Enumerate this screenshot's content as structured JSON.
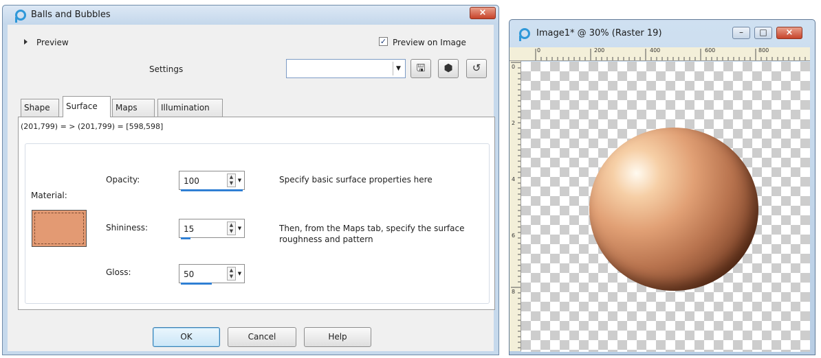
{
  "dialog": {
    "title": "Balls and Bubbles",
    "close_glyph": "×",
    "preview_label": "Preview",
    "preview_on_image_label": "Preview on Image",
    "preview_on_image_checked": true,
    "settings_label": "Settings",
    "settings_value": "",
    "tabs": [
      {
        "label": "Shape",
        "active": false
      },
      {
        "label": "Surface",
        "active": true
      },
      {
        "label": "Maps",
        "active": false
      },
      {
        "label": "Illumination",
        "active": false
      }
    ],
    "coord_readout": "(201,799) = > (201,799) = [598,598]",
    "material_label": "Material:",
    "material_color": "#e39a73",
    "fields": {
      "opacity": {
        "label": "Opacity:",
        "value": "100",
        "level": 1.0
      },
      "shininess": {
        "label": "Shininess:",
        "value": "15",
        "level": 0.15
      },
      "gloss": {
        "label": "Gloss:",
        "value": "50",
        "level": 0.5
      }
    },
    "help_text_1": "Specify basic surface properties here",
    "help_text_2": "Then, from the Maps tab, specify the surface roughness and pattern",
    "buttons": {
      "ok": "OK",
      "cancel": "Cancel",
      "help": "Help"
    }
  },
  "image_window": {
    "title": "Image1* @  30% (Raster 19)",
    "ruler_h_labels": [
      "0",
      "200",
      "400",
      "600",
      "800"
    ],
    "ruler_v_labels": [
      "0",
      "2",
      "4",
      "6",
      "8"
    ],
    "controls": {
      "minimize": "–",
      "maximize": "□",
      "close": "×"
    }
  },
  "colors": {
    "accent_blue": "#2f7fd4",
    "close_red": "#c7432a",
    "ruler_bg": "#f3efd9"
  }
}
